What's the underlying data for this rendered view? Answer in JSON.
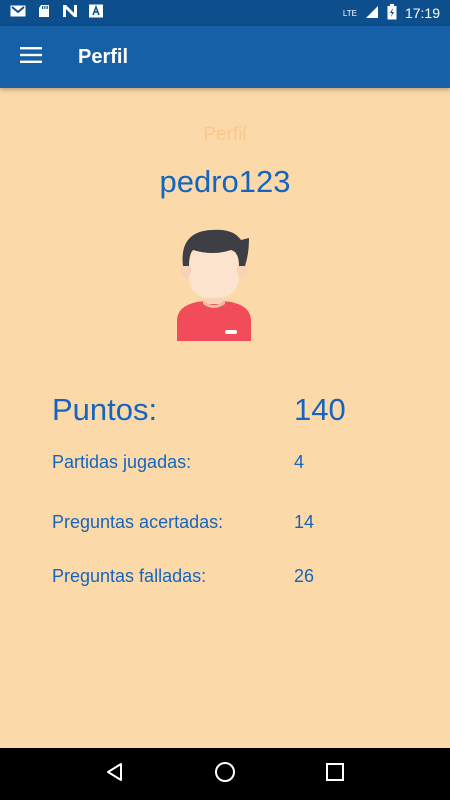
{
  "status_bar": {
    "time": "17:19",
    "network": "LTE",
    "icons": [
      "gmail-icon",
      "sd-card-icon",
      "n-app-icon",
      "a-app-icon",
      "signal-icon",
      "battery-charging-icon"
    ]
  },
  "app_bar": {
    "title": "Perfil",
    "menu_icon": "hamburger-menu-icon",
    "background": "#1560A6"
  },
  "profile": {
    "section_title": "Perfil",
    "username": "pedro123",
    "avatar_icon": "user-avatar-icon"
  },
  "stats": {
    "points_label": "Puntos:",
    "points_value": "140",
    "games_label": "Partidas jugadas:",
    "games_value": "4",
    "correct_label": "Preguntas acertadas:",
    "correct_value": "14",
    "failed_label": "Preguntas falladas:",
    "failed_value": "26"
  },
  "nav_bar": {
    "icons": [
      "back-icon",
      "home-icon",
      "recents-icon"
    ]
  },
  "colors": {
    "background": "#FCD9A8",
    "accent": "#1565C0",
    "status_bar": "#0D4E8C"
  }
}
